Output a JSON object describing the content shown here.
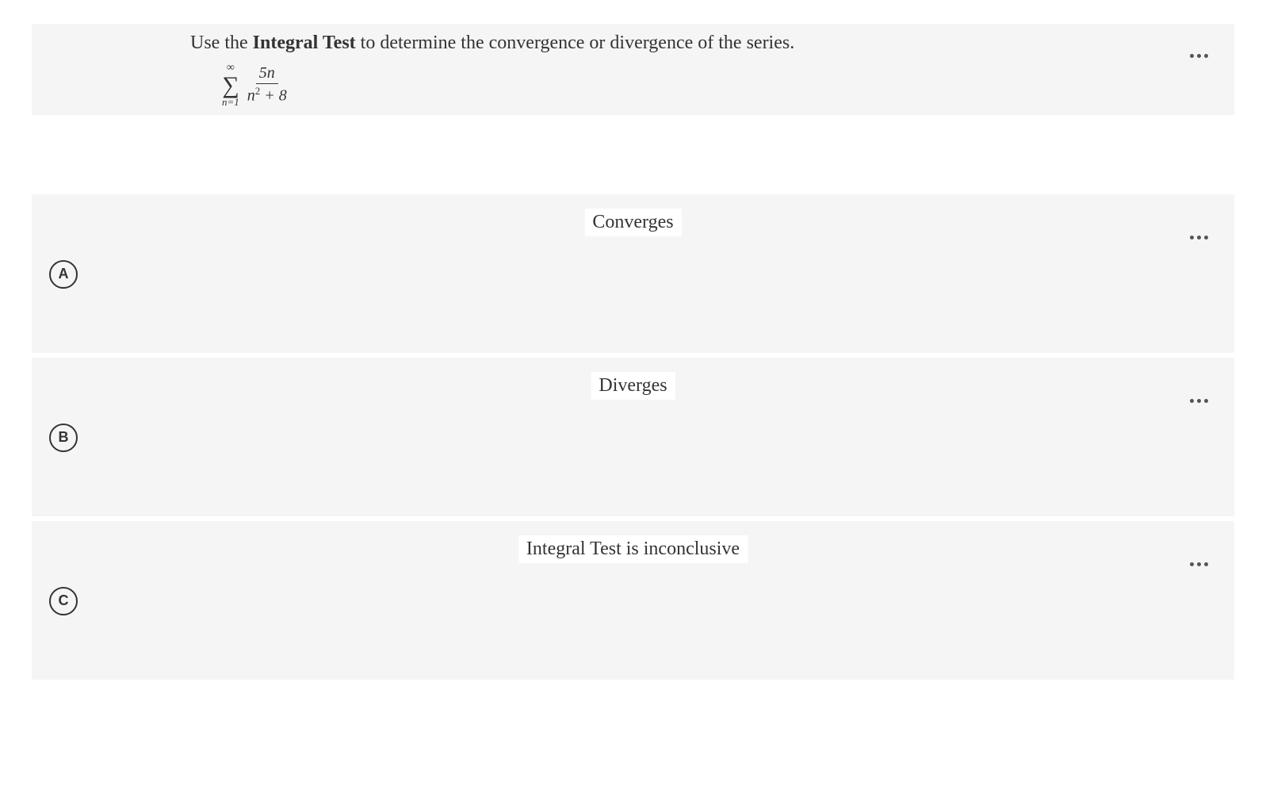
{
  "question": {
    "prompt_pre": "Use the ",
    "prompt_bold": "Integral Test",
    "prompt_post": " to determine the convergence or divergence of the series.",
    "sigma_top": "∞",
    "sigma_bottom": "n=1",
    "numerator": "5n",
    "denom_var": "n",
    "denom_exp": "2",
    "denom_rest": " + 8"
  },
  "answers": [
    {
      "label": "A",
      "text": "Converges"
    },
    {
      "label": "B",
      "text": "Diverges"
    },
    {
      "label": "C",
      "text": "Integral Test is inconclusive"
    }
  ]
}
